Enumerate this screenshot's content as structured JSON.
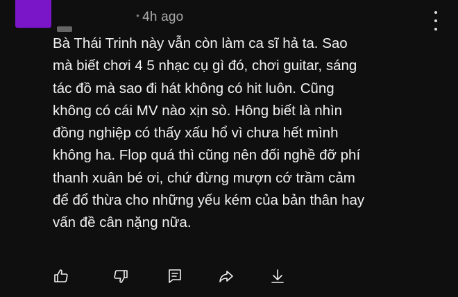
{
  "comment": {
    "timestamp": "4h ago",
    "lines": [
      "Bà Thái Trinh này vẫn còn làm ca sĩ hả ta. Sao",
      "mà biết chơi 4 5 nhạc cụ gì đó, chơi guitar, sáng",
      "tác đồ mà sao đi hát không có hit luôn. Cũng",
      "không có cái MV nào xịn sò. Hông biết là nhìn",
      "đồng nghiệp có thấy xấu hổ vì chưa hết mình",
      "không ha. Flop quá thì cũng nên đối nghề đỡ phí",
      "thanh xuân bé ơi, chứ đừng mượn cớ trầm cảm",
      "để đổ thừa cho những yếu kém của bản thân hay",
      "vấn đề cân nặng nữa."
    ]
  },
  "actions": [
    "thumbs-up-icon",
    "thumbs-down-icon",
    "reply-icon",
    "share-icon",
    "download-icon"
  ],
  "colors": {
    "background": "#0f0f0f",
    "text": "#f1f1f1",
    "meta": "#aaaaaa",
    "avatar": "#7b16c8"
  }
}
